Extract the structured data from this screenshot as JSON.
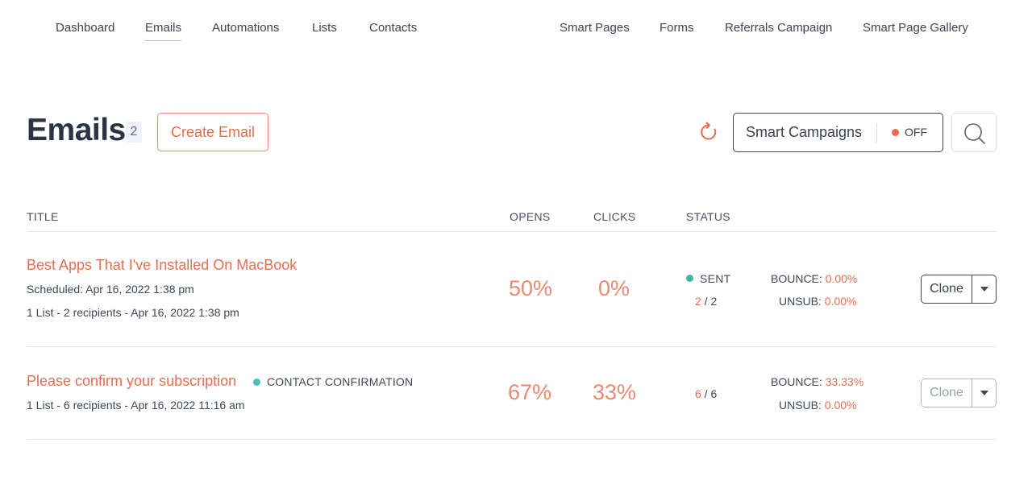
{
  "nav": {
    "left": [
      {
        "label": "Dashboard",
        "active": false
      },
      {
        "label": "Emails",
        "active": true
      },
      {
        "label": "Automations",
        "active": false
      },
      {
        "label": "Lists",
        "active": false
      },
      {
        "label": "Contacts",
        "active": false
      }
    ],
    "right": [
      {
        "label": "Smart Pages"
      },
      {
        "label": "Forms"
      },
      {
        "label": "Referrals Campaign"
      },
      {
        "label": "Smart Page Gallery"
      }
    ]
  },
  "header": {
    "title": "Emails",
    "count": "2",
    "create_label": "Create Email",
    "smart_campaigns_label": "Smart Campaigns",
    "smart_campaigns_state": "OFF"
  },
  "table": {
    "columns": {
      "title": "TITLE",
      "opens": "OPENS",
      "clicks": "CLICKS",
      "status": "STATUS"
    },
    "rows": [
      {
        "title": "Best Apps That I've Installed On MacBook",
        "scheduled": "Scheduled: Apr 16, 2022 1:38 pm",
        "details": "1 List - 2 recipients - Apr 16, 2022 1:38 pm",
        "opens": "50%",
        "clicks": "0%",
        "status": "SENT",
        "sent": "2",
        "total": "2",
        "bounce_label": "BOUNCE:",
        "bounce": "0.00%",
        "unsub_label": "UNSUB:",
        "unsub": "0.00%",
        "clone_label": "Clone"
      },
      {
        "title": "Please confirm your subscription",
        "type": "CONTACT CONFIRMATION",
        "details": "1 List - 6 recipients - Apr 16, 2022 11:16 am",
        "opens": "67%",
        "clicks": "33%",
        "sent": "6",
        "total": "6",
        "bounce_label": "BOUNCE:",
        "bounce": "33.33%",
        "unsub_label": "UNSUB:",
        "unsub": "0.00%",
        "clone_label": "Clone"
      }
    ]
  },
  "colors": {
    "accent": "#e36f52",
    "sent_status": "#3cb7a3",
    "type_dot": "#4bc0b4",
    "off_indicator": "#e86b4c"
  },
  "icons": {
    "refresh": "refresh-icon",
    "search": "search-icon",
    "dropdown": "caret-down-icon"
  }
}
